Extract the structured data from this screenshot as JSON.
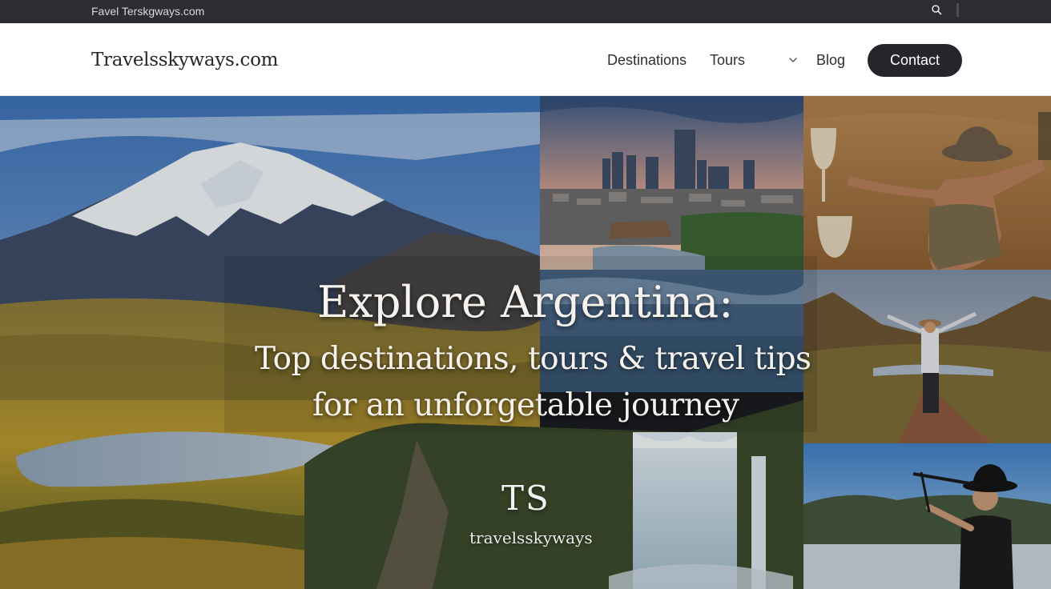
{
  "topbar": {
    "site_text": "Favel Terskgways.com",
    "search_icon": "search-icon"
  },
  "header": {
    "logo": "Travelsskyways.com",
    "nav": [
      {
        "label": "Destinations"
      },
      {
        "label": "Tours",
        "icon": "chevron-down-icon"
      },
      {
        "label": "Blog"
      }
    ],
    "contact_label": "Contact"
  },
  "hero": {
    "title_line1": "Explore Argentina:",
    "title_line2": "Top destinations, tours & travel tips",
    "title_line3": "for an unforgetable journey",
    "monogram": "TS",
    "brand": "travelsskyways"
  },
  "colors": {
    "topbar_bg": "#2b2d33",
    "header_bg": "#ffffff",
    "contact_bg": "#24262b",
    "hero_text": "#f6f3ee"
  }
}
